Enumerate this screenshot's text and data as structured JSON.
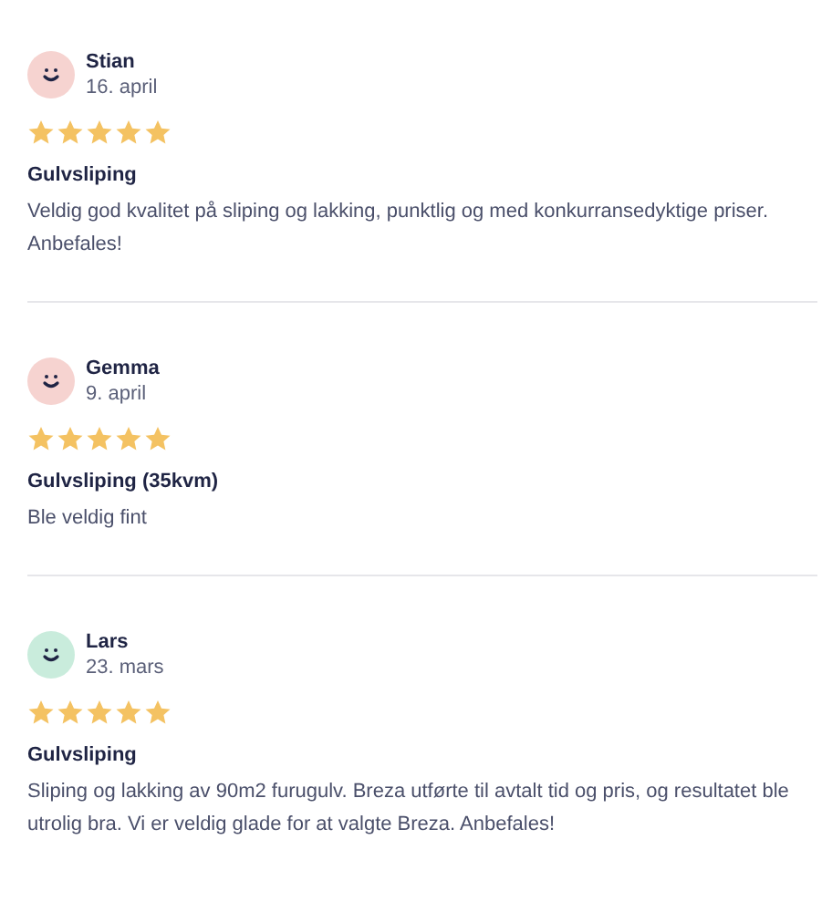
{
  "reviews": [
    {
      "name": "Stian",
      "date": "16. april",
      "color": "#f6d3d0",
      "stars": 5,
      "title": "Gulvsliping",
      "text": "Veldig god kvalitet på sliping og lakking, punktlig og med konkurransedyktige priser. Anbefales!"
    },
    {
      "name": "Gemma",
      "date": "9. april",
      "color": "#f6d3d0",
      "stars": 5,
      "title": "Gulvsliping (35kvm)",
      "text": "Ble veldig fint"
    },
    {
      "name": "Lars",
      "date": "23. mars",
      "color": "#c9ecdc",
      "stars": 5,
      "title": "Gulvsliping",
      "text": "Sliping og lakking av 90m2 furugulv. Breza utførte til avtalt tid og pris, og resultatet ble utrolig bra. Vi er veldig glade for at valgte Breza. Anbefales!"
    }
  ]
}
